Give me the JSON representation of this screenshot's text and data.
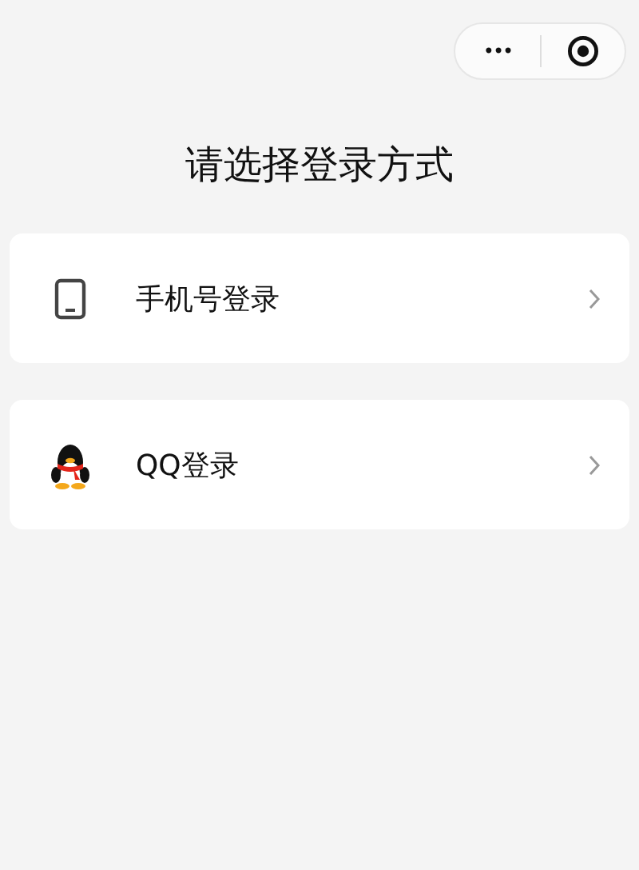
{
  "capsule": {
    "more": "•••"
  },
  "title": "请选择登录方式",
  "options": [
    {
      "kind": "phone",
      "label": "手机号登录"
    },
    {
      "kind": "penguin",
      "label": "QQ登录"
    }
  ]
}
